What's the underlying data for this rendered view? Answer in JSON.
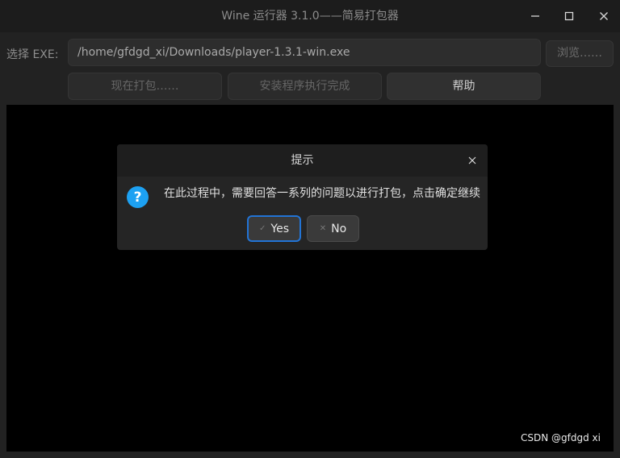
{
  "window": {
    "title": "Wine 运行器 3.1.0——简易打包器",
    "controls": {
      "minimize_icon": "minimize-icon",
      "maximize_icon": "maximize-icon",
      "close_icon": "close-icon"
    }
  },
  "form": {
    "exe_label": "选择 EXE:",
    "exe_path": "/home/gfdgd_xi/Downloads/player-1.3.1-win.exe",
    "browse_label": "浏览……"
  },
  "actions": {
    "pack_label": "现在打包……",
    "installer_done_label": "安装程序执行完成",
    "help_label": "帮助"
  },
  "dialog": {
    "title": "提示",
    "message": "在此过程中，需要回答一系列的问题以进行打包，点击确定继续",
    "yes_label": "Yes",
    "no_label": "No",
    "icon": "question-icon"
  },
  "watermark": "CSDN @gfdgd xi",
  "colors": {
    "accent": "#2274d6",
    "question_icon": "#1da1f2",
    "terminal_bg": "#000000"
  }
}
